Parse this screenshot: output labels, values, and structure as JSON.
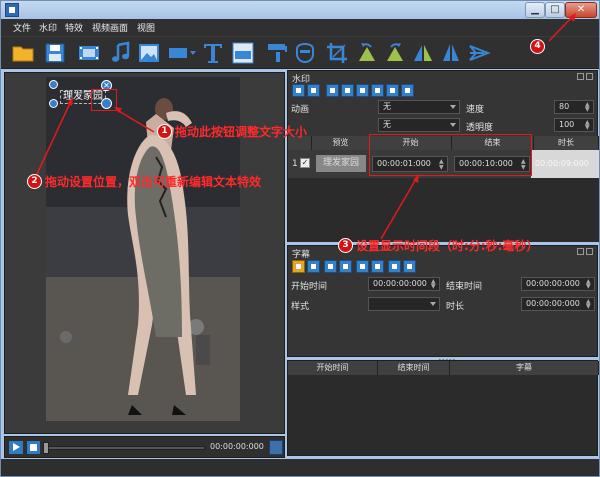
{
  "menu": [
    "文件",
    "水印",
    "特效",
    "视频画面",
    "视图"
  ],
  "toolbar": {
    "icons": [
      "open-folder-icon",
      "save-icon",
      "video-film-icon",
      "music-note-icon",
      "image-icon",
      "shape-rect-icon",
      "text-t-icon",
      "subtitle-ass-icon",
      "brush-icon",
      "mask-icon",
      "crop-icon",
      "rotate-left-icon",
      "rotate-right-icon",
      "flip-horizontal-icon",
      "flip-vertical-icon",
      "speed-icon"
    ]
  },
  "preview": {
    "overlay_text": "理发家园",
    "time": "00:00:00:000"
  },
  "watermark_panel": {
    "title": "水印",
    "animation_label": "动画",
    "animation_value": "无",
    "second_value": "无",
    "speed_label": "速度",
    "speed_value": "80",
    "opacity_label": "透明度",
    "opacity_value": "100",
    "table": {
      "headers": [
        "预览",
        "开始",
        "结束",
        "时长"
      ],
      "rows": [
        {
          "index": "1",
          "preview": "理发家园",
          "start": "00:00:01:000",
          "end": "00:00:10:000",
          "duration": "00:00:09:000"
        }
      ]
    }
  },
  "subtitle_panel": {
    "title": "字幕",
    "start_label": "开始时间",
    "start_value": "00:00:00:000",
    "end_label": "结束时间",
    "end_value": "00:00:00:000",
    "style_label": "样式",
    "duration_label": "时长",
    "duration_value": "00:00:00:000",
    "table_headers": [
      "开始时间",
      "结束时间",
      "字幕"
    ]
  },
  "annotations": {
    "a1": {
      "num": "1",
      "text": "拖动此按钮调整文字大小"
    },
    "a2": {
      "num": "2",
      "text": "拖动设置位置，双击可重新编辑文本特效"
    },
    "a3": {
      "num": "3",
      "text": "设置显示时间段（时:分:秒:毫秒）"
    },
    "a4": {
      "num": "4"
    }
  },
  "colors": {
    "accent": "#3680c7",
    "annotation_red": "#e31a1a",
    "panel": "#353535"
  }
}
